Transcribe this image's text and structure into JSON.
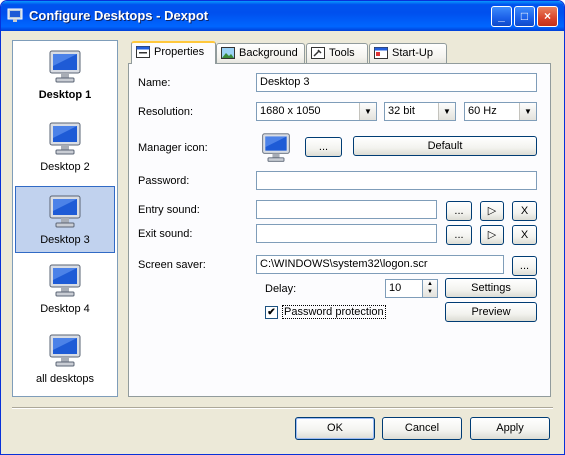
{
  "window": {
    "title": "Configure Desktops - Dexpot",
    "minimize": "_",
    "maximize": "□",
    "close": "×"
  },
  "sidebar": {
    "items": [
      {
        "label": "Desktop 1"
      },
      {
        "label": "Desktop 2"
      },
      {
        "label": "Desktop 3"
      },
      {
        "label": "Desktop 4"
      },
      {
        "label": "all desktops"
      }
    ]
  },
  "tabs": [
    "Properties",
    "Background",
    "Tools",
    "Start-Up"
  ],
  "form": {
    "name_label": "Name:",
    "name_value": "Desktop 3",
    "resolution_label": "Resolution:",
    "resolution_value": "1680 x 1050",
    "color_depth_value": "32 bit",
    "refresh_value": "60 Hz",
    "manager_icon_label": "Manager icon:",
    "browse_label": "...",
    "default_label": "Default",
    "password_label": "Password:",
    "password_value": "",
    "entry_sound_label": "Entry sound:",
    "entry_sound_value": "",
    "exit_sound_label": "Exit sound:",
    "exit_sound_value": "",
    "clear_label": "X",
    "play_label": "▷",
    "screensaver_label": "Screen saver:",
    "screensaver_value": "C:\\WINDOWS\\system32\\logon.scr",
    "delay_label": "Delay:",
    "delay_value": "10",
    "settings_label": "Settings",
    "password_protection_label": "Password protection",
    "password_protection_checked": "✔",
    "preview_label": "Preview"
  },
  "footer": {
    "ok_label": "OK",
    "cancel_label": "Cancel",
    "apply_label": "Apply"
  },
  "colors": {
    "title_bar": "#0053ee",
    "window_bg": "#ece9d8",
    "selected_item": "#c1d2ee"
  }
}
